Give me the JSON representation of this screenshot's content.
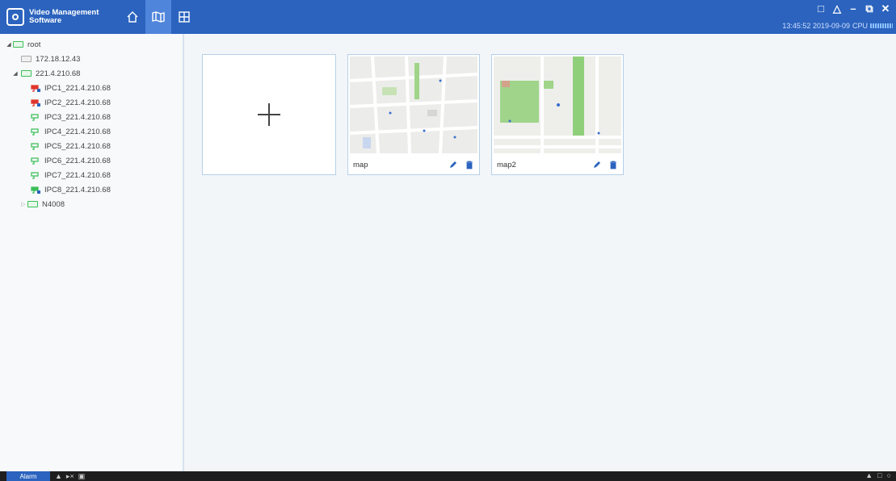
{
  "app": {
    "title_line1": "Video Management",
    "title_line2": "Software"
  },
  "nav": [
    {
      "icon": "home-icon"
    },
    {
      "icon": "map-icon",
      "active": true
    },
    {
      "icon": "layout-grid-icon"
    }
  ],
  "window_controls": [
    "chat-icon",
    "user-icon",
    "minimize-icon",
    "restore-icon",
    "close-icon"
  ],
  "status": {
    "datetime": "13:45:52 2019-09-09",
    "cpu_label": "CPU"
  },
  "tree": {
    "root": "root",
    "ip1": "172.18.12.43",
    "ip2": "221.4.210.68",
    "cameras": [
      {
        "label": "IPC1_221.4.210.68",
        "state": "alarm"
      },
      {
        "label": "IPC2_221.4.210.68",
        "state": "alarm"
      },
      {
        "label": "IPC3_221.4.210.68",
        "state": "online"
      },
      {
        "label": "IPC4_221.4.210.68",
        "state": "online"
      },
      {
        "label": "IPC5_221.4.210.68",
        "state": "online"
      },
      {
        "label": "IPC6_221.4.210.68",
        "state": "online"
      },
      {
        "label": "IPC7_221.4.210.68",
        "state": "online"
      },
      {
        "label": "IPC8_221.4.210.68",
        "state": "recording"
      }
    ],
    "nvr": "N4008"
  },
  "maps": [
    {
      "name": "map"
    },
    {
      "name": "map2"
    }
  ],
  "bottom": {
    "alarm_label": "Alarm"
  },
  "colors": {
    "titlebar": "#2b63be",
    "active_nav": "#4f85db",
    "online": "#3cbf5a",
    "alarm": "#e0362c",
    "accent": "#2b63be"
  }
}
